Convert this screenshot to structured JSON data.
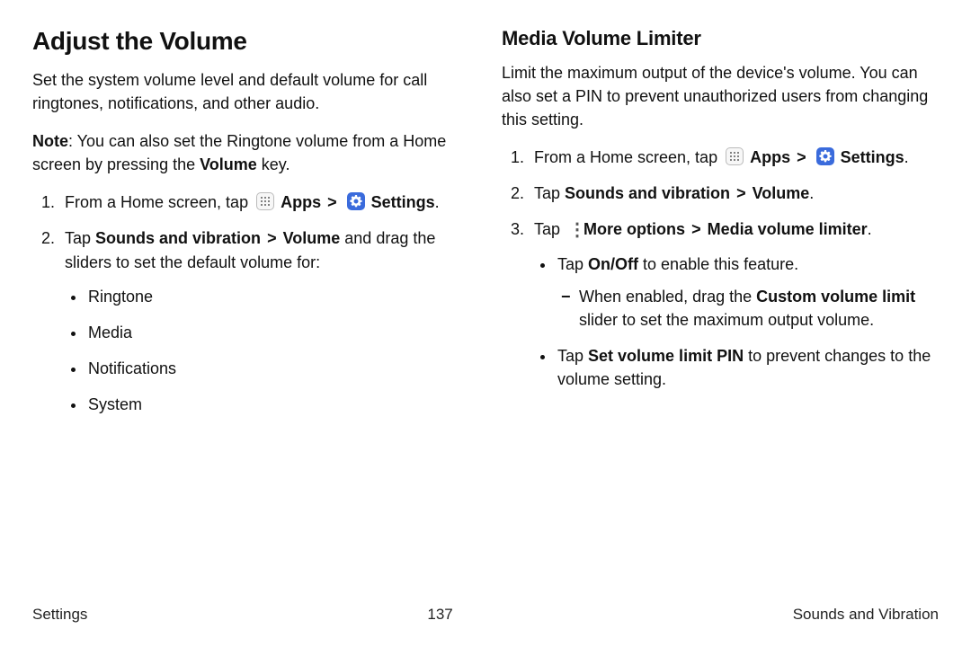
{
  "left": {
    "h1": "Adjust the Volume",
    "intro": "Set the system volume level and default volume for call ringtones, notifications, and other audio.",
    "note_label": "Note",
    "note_1": ": You can also set the Ringtone volume from a Home screen by pressing the ",
    "note_bold": "Volume",
    "note_2": " key.",
    "step1_a": "From a Home screen, tap ",
    "apps": "Apps",
    "settings": "Settings",
    "period": ".",
    "step2_a": "Tap ",
    "step2_b": "Sounds and vibration",
    "step2_c": "Volume",
    "step2_d": " and drag the sliders to set the default volume for:",
    "bullets": {
      "ringtone": "Ringtone",
      "media": "Media",
      "notifications": "Notifications",
      "system": "System"
    }
  },
  "right": {
    "h2": "Media Volume Limiter",
    "intro": "Limit the maximum output of the device's volume. You can also set a PIN to prevent unauthorized users from changing this setting.",
    "step1_a": "From a Home screen, tap ",
    "step2_a": "Tap ",
    "step2_b": "Sounds and vibration",
    "step2_c": "Volume",
    "step3_a": "Tap ",
    "step3_b": "More options",
    "step3_c": "Media volume limiter",
    "bullet_onoff_a": "Tap ",
    "bullet_onoff_b": "On/Off",
    "bullet_onoff_c": " to enable this feature.",
    "dash_a": "When enabled, drag the ",
    "dash_b": "Custom volume limit",
    "dash_c": " slider to set the maximum output volume.",
    "bullet_pin_a": "Tap ",
    "bullet_pin_b": "Set volume limit PIN",
    "bullet_pin_c": " to prevent changes to the volume setting."
  },
  "sep": ">",
  "footer": {
    "left": "Settings",
    "center": "137",
    "right": "Sounds and Vibration"
  }
}
